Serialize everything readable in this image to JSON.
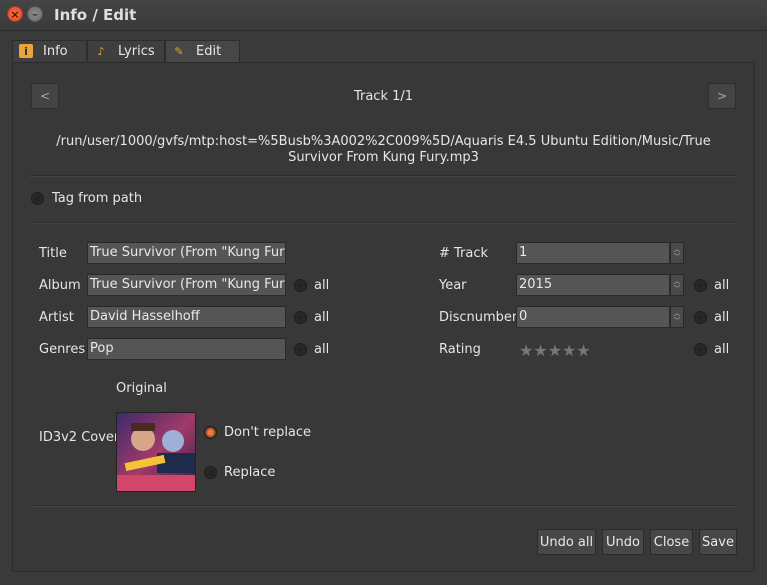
{
  "window": {
    "title": "Info / Edit"
  },
  "tabs": [
    {
      "label": "Info",
      "icon": "info-icon"
    },
    {
      "label": "Lyrics",
      "icon": "music-note-icon"
    },
    {
      "label": "Edit",
      "icon": "pencil-icon"
    }
  ],
  "nav": {
    "prev": "<",
    "next": ">",
    "track_label": "Track 1/1"
  },
  "path": "/run/user/1000/gvfs/mtp:host=%5Busb%3A002%2C009%5D/Aquaris E4.5 Ubuntu Edition/Music/True Survivor From Kung Fury.mp3",
  "tag_from_path": "Tag from path",
  "fields": {
    "title": {
      "label": "Title",
      "value": "True Survivor (From \"Kung Fury\")"
    },
    "album": {
      "label": "Album",
      "value": "True Survivor (From \"Kung Fury\")",
      "all": "all"
    },
    "artist": {
      "label": "Artist",
      "value": "David Hasselhoff",
      "all": "all"
    },
    "genres": {
      "label": "Genres",
      "value": "Pop",
      "all": "all"
    },
    "track": {
      "label": "# Track",
      "value": "1"
    },
    "year": {
      "label": "Year",
      "value": "2015",
      "all": "all"
    },
    "discnumber": {
      "label": "Discnumber",
      "value": "0",
      "all": "all"
    },
    "rating": {
      "label": "Rating",
      "stars": "★★★★★",
      "value": 0,
      "all": "all"
    }
  },
  "cover": {
    "original": "Original",
    "label": "ID3v2 Cover",
    "dont_replace": "Don't replace",
    "replace": "Replace"
  },
  "buttons": {
    "undo_all": "Undo all",
    "undo": "Undo",
    "close": "Close",
    "save": "Save"
  },
  "colors": {
    "accent": "#f07a3c",
    "background": "#3a3a3a"
  }
}
